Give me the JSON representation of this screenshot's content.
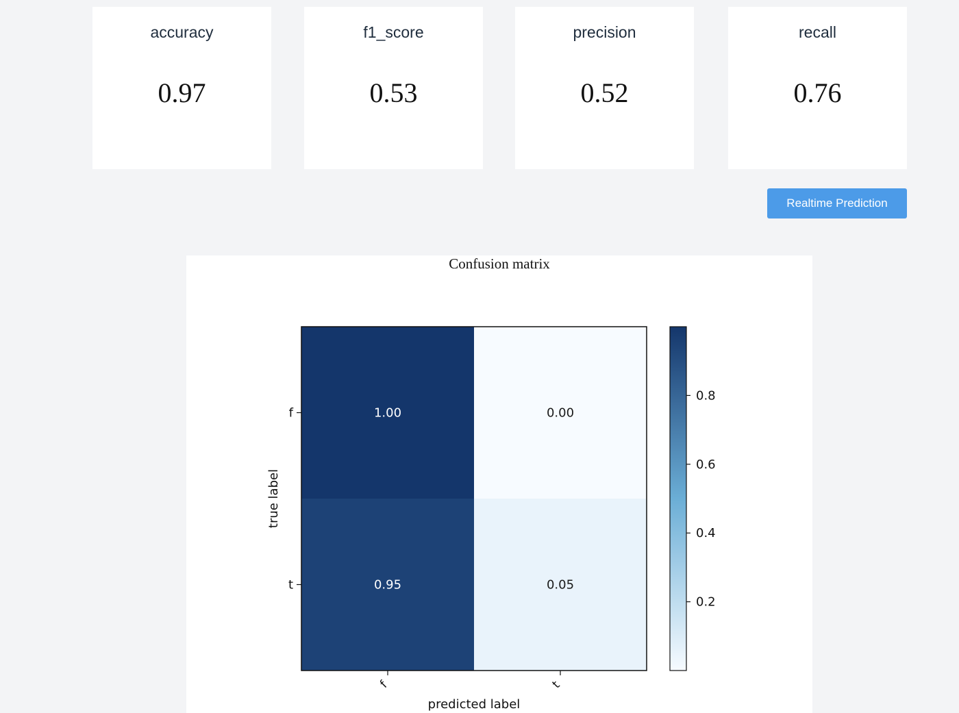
{
  "metrics": [
    {
      "label": "accuracy",
      "value": "0.97"
    },
    {
      "label": "f1_score",
      "value": "0.53"
    },
    {
      "label": "precision",
      "value": "0.52"
    },
    {
      "label": "recall",
      "value": "0.76"
    }
  ],
  "actions": {
    "realtime_label": "Realtime Prediction"
  },
  "colors": {
    "page_bg": "#f3f4f6",
    "button": "#4c9be8",
    "cmap_high": "#14366b",
    "cmap_low": "#f7fbff"
  },
  "chart_data": {
    "type": "heatmap",
    "title": "Confusion matrix",
    "xlabel": "predicted label",
    "ylabel": "true label",
    "x_categories": [
      "f",
      "t"
    ],
    "y_categories": [
      "f",
      "t"
    ],
    "values": [
      [
        1.0,
        0.0
      ],
      [
        0.95,
        0.05
      ]
    ],
    "cell_labels": [
      [
        "1.00",
        "0.00"
      ],
      [
        "0.95",
        "0.05"
      ]
    ],
    "colorbar": {
      "range": [
        0,
        1
      ],
      "ticks": [
        0.2,
        0.4,
        0.6,
        0.8
      ],
      "tick_labels": [
        "0.2",
        "0.4",
        "0.6",
        "0.8"
      ]
    }
  }
}
